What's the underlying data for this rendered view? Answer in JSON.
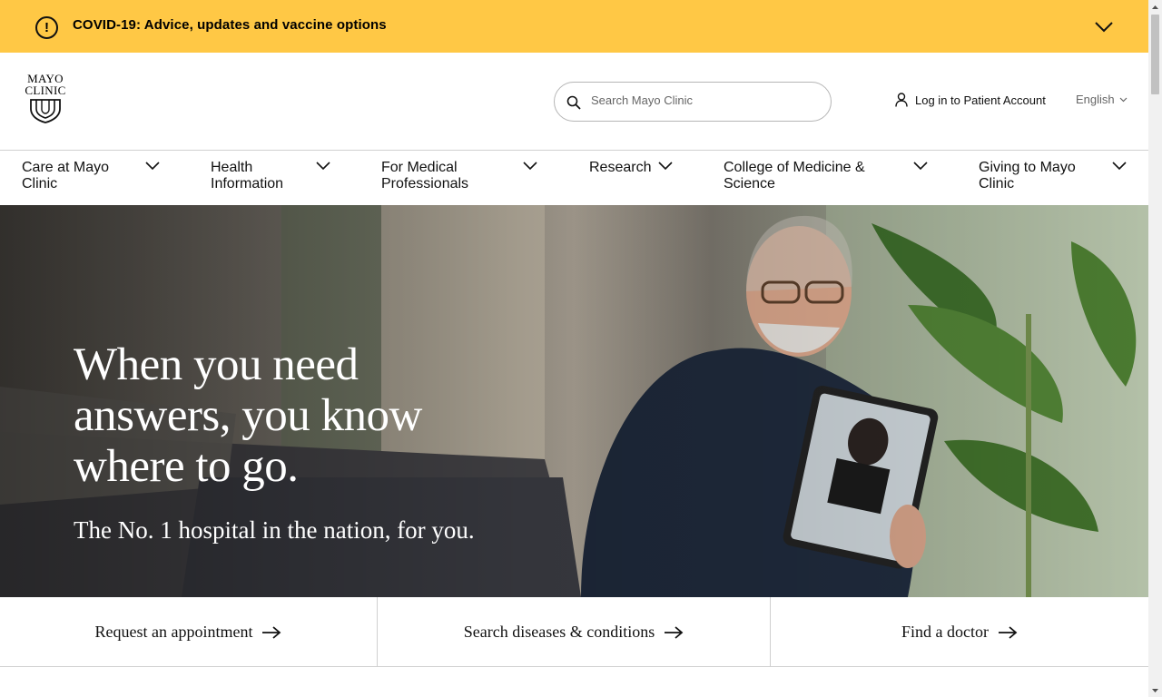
{
  "alert": {
    "text": "COVID-19: Advice, updates and vaccine options",
    "icon": "exclamation-circle-icon"
  },
  "header": {
    "logo": {
      "line1": "MAYO",
      "line2": "CLINIC"
    },
    "search": {
      "placeholder": "Search Mayo Clinic"
    },
    "login_label": "Log in to Patient Account",
    "language": "English"
  },
  "nav": {
    "items": [
      {
        "label": "Care at Mayo Clinic"
      },
      {
        "label": "Health Information"
      },
      {
        "label": "For Medical Professionals"
      },
      {
        "label": "Research"
      },
      {
        "label": "College of Medicine & Science"
      },
      {
        "label": "Giving to Mayo Clinic"
      }
    ]
  },
  "hero": {
    "title": "When you need answers, you know where to go.",
    "subtitle": "The No. 1 hospital in the nation, for you."
  },
  "quick_links": [
    {
      "label": "Request an appointment"
    },
    {
      "label": "Search diseases & conditions"
    },
    {
      "label": "Find a doctor"
    }
  ],
  "colors": {
    "alert_bg": "#ffc845",
    "text": "#111111",
    "border": "#d0d0d0"
  }
}
